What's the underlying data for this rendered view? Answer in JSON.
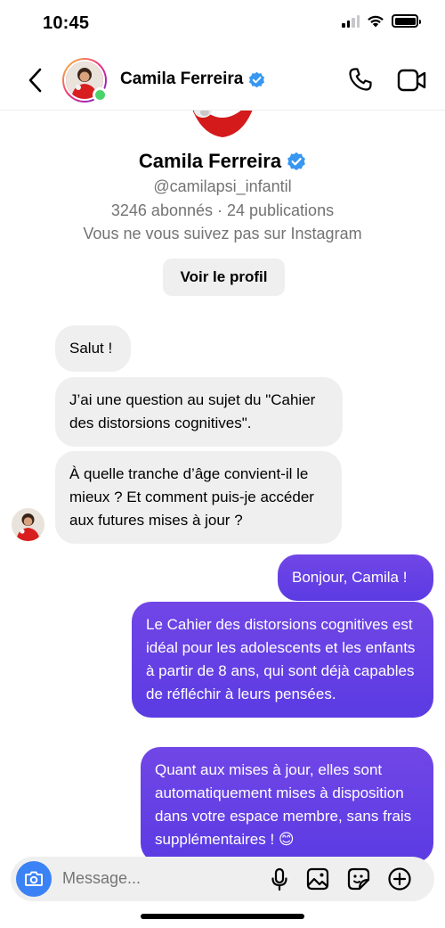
{
  "status_bar": {
    "time": "10:45"
  },
  "header": {
    "name": "Camila Ferreira"
  },
  "profile": {
    "name": "Camila Ferreira",
    "handle": "@camilapsi_infantil",
    "stats": "3246 abonnés · 24 publications",
    "follow_status": "Vous ne vous suivez pas sur Instagram",
    "view_profile_label": "Voir le profil"
  },
  "messages": [
    {
      "from": "them",
      "text": "Salut !"
    },
    {
      "from": "them",
      "text": "J’ai une question au sujet du \"Cahier des distorsions cognitives\"."
    },
    {
      "from": "them",
      "text": "À quelle tranche d’âge convient-il le mieux ? Et comment puis-je accéder aux futures mises à jour ?"
    },
    {
      "from": "me",
      "text": "Bonjour, Camila !"
    },
    {
      "from": "me",
      "text": "Le Cahier des distorsions cognitives est idéal pour les adolescents et les enfants à partir de 8 ans, qui sont déjà capables de réfléchir à leurs pensées."
    },
    {
      "from": "me",
      "text": "Quant aux mises à jour, elles sont automatiquement mises à disposition dans votre espace membre, sans frais supplémentaires ! 😊"
    }
  ],
  "composer": {
    "placeholder": "Message..."
  },
  "colors": {
    "outgoing_bubble": "#6a3ee8",
    "incoming_bubble": "#efefef",
    "verified": "#3897f0",
    "online": "#4bd36b",
    "camera_button": "#3b82f6"
  }
}
